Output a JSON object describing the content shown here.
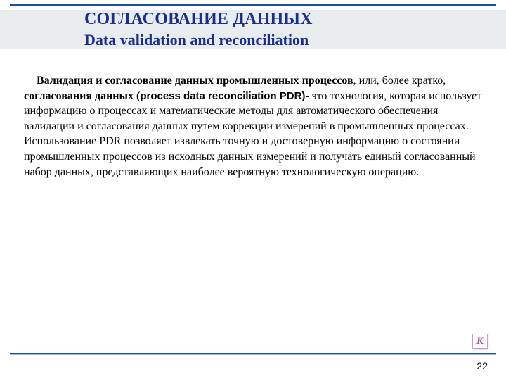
{
  "header": {
    "title_ru": "СОГЛАСОВАНИЕ ДАННЫХ",
    "title_en": "Data validation and reconciliation"
  },
  "body": {
    "lead_bold": "Валидация и согласование данных промышленных процессов",
    "after_lead": ", или, более кратко, ",
    "bold2_ru": "согласования данных (",
    "bold2_en": "process data reconciliation  PDR)",
    "rest": "- это технология, которая использует информацию о процессах и математические методы для автоматического обеспечения валидации и согласования данных путем коррекции измерений в промышленных процессах. Использование PDR позволяет извлекать точную и достоверную информацию о состоянии промышленных процессов из исходных данных измерений и получать единый согласованный набор данных, представляющих наиболее вероятную технологическую операцию."
  },
  "footer": {
    "logo_letter": "К",
    "page_number": "22"
  }
}
